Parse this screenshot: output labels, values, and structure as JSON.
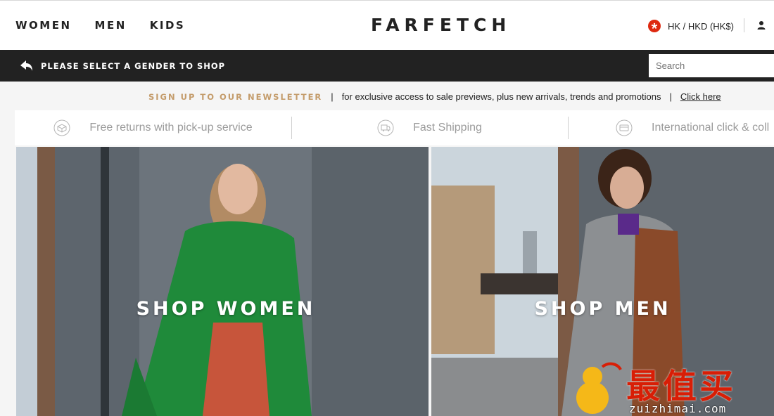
{
  "header": {
    "nav": [
      "WOMEN",
      "MEN",
      "KIDS"
    ],
    "logo": "FARFETCH",
    "locale": "HK / HKD (HK$)"
  },
  "gender_bar": {
    "prompt": "PLEASE SELECT A GENDER TO SHOP",
    "search_placeholder": "Search"
  },
  "newsletter": {
    "title": "SIGN UP TO OUR NEWSLETTER",
    "text": "for exclusive access to sale previews, plus new arrivals, trends and promotions",
    "link": "Click here",
    "separator": "|"
  },
  "usp": [
    {
      "label": "Free returns with pick-up service",
      "icon": "box-icon"
    },
    {
      "label": "Fast Shipping",
      "icon": "shipping-icon"
    },
    {
      "label": "International click & coll",
      "icon": "card-icon"
    }
  ],
  "heroes": {
    "women": "SHOP WOMEN",
    "men": "SHOP MEN"
  },
  "watermark": {
    "cjk": "最值买",
    "url": "zuizhimai.com"
  },
  "colors": {
    "accent_gold": "#c49c6b",
    "bar_black": "#222222",
    "flag_red": "#de2910"
  }
}
